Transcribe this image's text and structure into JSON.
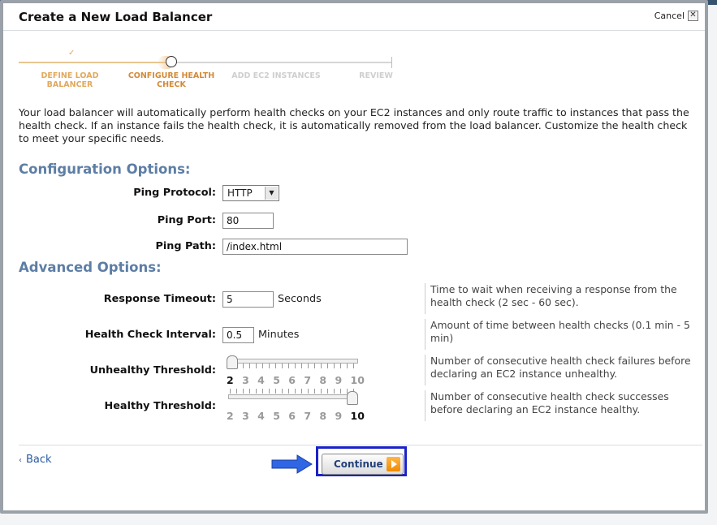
{
  "modal": {
    "title": "Create a New Load Balancer",
    "cancel_label": "Cancel",
    "close_symbol": "✕"
  },
  "wizard": {
    "steps": [
      {
        "label": "Define Load Balancer",
        "state": "done"
      },
      {
        "label": "Configure Health Check",
        "state": "active"
      },
      {
        "label": "Add EC2 Instances",
        "state": "todo"
      },
      {
        "label": "Review",
        "state": "todo"
      }
    ],
    "check_symbol": "✓"
  },
  "intro": "Your load balancer will automatically perform health checks on your EC2 instances and only route traffic to instances that pass the health check. If an instance fails the health check, it is automatically removed from the load balancer. Customize the health check to meet your specific needs.",
  "config": {
    "title": "Configuration Options:",
    "ping_protocol": {
      "label": "Ping Protocol:",
      "value": "HTTP"
    },
    "ping_port": {
      "label": "Ping Port:",
      "value": "80"
    },
    "ping_path": {
      "label": "Ping Path:",
      "value": "/index.html"
    }
  },
  "advanced": {
    "title": "Advanced Options:",
    "response_timeout": {
      "label": "Response Timeout:",
      "value": "5",
      "unit": "Seconds",
      "help": "Time to wait when receiving a response from the health check (2 sec - 60 sec)."
    },
    "interval": {
      "label": "Health Check Interval:",
      "value": "0.5",
      "unit": "Minutes",
      "help": "Amount of time between health checks (0.1 min - 5 min)"
    },
    "unhealthy": {
      "label": "Unhealthy Threshold:",
      "values": [
        "2",
        "3",
        "4",
        "5",
        "6",
        "7",
        "8",
        "9",
        "10"
      ],
      "selected": 2,
      "min": 2,
      "max": 10,
      "help": "Number of consecutive health check failures before declaring an EC2 instance unhealthy."
    },
    "healthy": {
      "label": "Healthy Threshold:",
      "values": [
        "2",
        "3",
        "4",
        "5",
        "6",
        "7",
        "8",
        "9",
        "10"
      ],
      "selected": 10,
      "min": 2,
      "max": 10,
      "help": "Number of consecutive health check successes before declaring an EC2 instance healthy."
    }
  },
  "footer": {
    "back_label": "Back",
    "back_symbol": "‹",
    "continue_label": "Continue"
  },
  "colors": {
    "section_title": "#5d7ea5",
    "wizard_done": "#e1a95c",
    "focus_border": "#1b22c7",
    "arrow": "#2f66e6"
  },
  "icons": [
    "close-icon",
    "check-icon",
    "dropdown-arrow-icon",
    "arrow-right-icon",
    "play-icon"
  ]
}
